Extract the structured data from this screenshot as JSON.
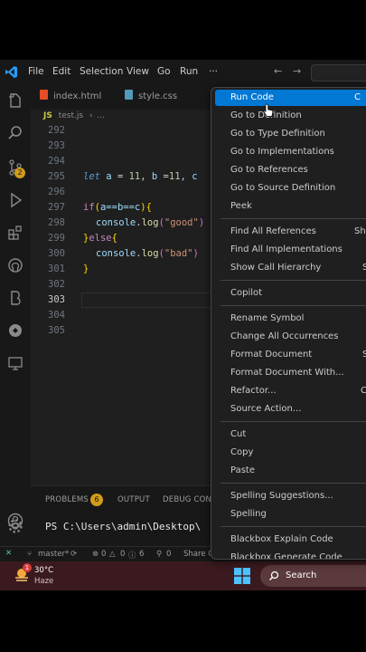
{
  "menubar": {
    "items": [
      "File",
      "Edit",
      "Selection",
      "View",
      "Go",
      "Run"
    ],
    "more": "···",
    "nav_back": "←",
    "nav_forward": "→"
  },
  "tabs": [
    {
      "label": "index.html",
      "icon_color": "#e44d26",
      "active": false
    },
    {
      "label": "style.css",
      "icon_color": "#519aba",
      "active": false
    }
  ],
  "breadcrumb": {
    "lang": "JS",
    "file": "test.js",
    "rest": "..."
  },
  "editor": {
    "line_numbers": [
      "292",
      "293",
      "294",
      "295",
      "296",
      "297",
      "298",
      "299",
      "300",
      "301",
      "302",
      "303",
      "304",
      "305"
    ],
    "active_line": "303",
    "code": {
      "l295": {
        "kw": "let",
        "a": "a",
        "eq1": " = ",
        "n1": "11",
        "comma": ", ",
        "b": "b",
        "eq2": " =",
        "n2": "11",
        "rest": ", c"
      },
      "l297": {
        "kw": "if",
        "open": "(",
        "cond": "a==b==c",
        "close": ")",
        "brace": "{"
      },
      "l298": {
        "obj": "console",
        "dot": ".",
        "fn": "log",
        "open": "(",
        "str": "\"good\"",
        "close": ")"
      },
      "l299": {
        "close": "}",
        "kw": "else",
        "open": "{"
      },
      "l300": {
        "obj": "console",
        "dot": ".",
        "fn": "log",
        "open": "(",
        "str": "\"bad\"",
        "close": ")"
      },
      "l301": {
        "close": "}"
      }
    }
  },
  "panel": {
    "tabs": [
      "PROBLEMS",
      "OUTPUT",
      "DEBUG CONS"
    ],
    "problems_count": "6",
    "terminal_text": "PS C:\\Users\\admin\\Desktop\\"
  },
  "statusbar": {
    "branch": "master*",
    "errors": "0",
    "warnings": "0",
    "info": "6",
    "ports": "0",
    "share": "Share C"
  },
  "taskbar": {
    "notification_count": "1",
    "temperature": "30°C",
    "condition": "Haze",
    "search_label": "Search"
  },
  "context_menu": {
    "groups": [
      [
        {
          "label": "Run Code",
          "shortcut": "C",
          "selected": true
        },
        {
          "label": "Go to Definition",
          "shortcut": ""
        },
        {
          "label": "Go to Type Definition",
          "shortcut": ""
        },
        {
          "label": "Go to Implementations",
          "shortcut": ""
        },
        {
          "label": "Go to References",
          "shortcut": ""
        },
        {
          "label": "Go to Source Definition",
          "shortcut": ""
        },
        {
          "label": "Peek",
          "shortcut": ""
        }
      ],
      [
        {
          "label": "Find All References",
          "shortcut": "Shi"
        },
        {
          "label": "Find All Implementations",
          "shortcut": ""
        },
        {
          "label": "Show Call Hierarchy",
          "shortcut": "S"
        }
      ],
      [
        {
          "label": "Copilot",
          "shortcut": ""
        }
      ],
      [
        {
          "label": "Rename Symbol",
          "shortcut": ""
        },
        {
          "label": "Change All Occurrences",
          "shortcut": ""
        },
        {
          "label": "Format Document",
          "shortcut": "S"
        },
        {
          "label": "Format Document With...",
          "shortcut": ""
        },
        {
          "label": "Refactor...",
          "shortcut": "C"
        },
        {
          "label": "Source Action...",
          "shortcut": ""
        }
      ],
      [
        {
          "label": "Cut",
          "shortcut": ""
        },
        {
          "label": "Copy",
          "shortcut": ""
        },
        {
          "label": "Paste",
          "shortcut": ""
        }
      ],
      [
        {
          "label": "Spelling Suggestions...",
          "shortcut": ""
        },
        {
          "label": "Spelling",
          "shortcut": ""
        }
      ],
      [
        {
          "label": "Blackbox Explain Code",
          "shortcut": ""
        },
        {
          "label": "Blackbox Generate Code",
          "shortcut": ""
        }
      ]
    ]
  },
  "colors": {
    "accent": "#0078d4",
    "badge": "#d09c1a",
    "taskbar": "#3a1a1e"
  }
}
